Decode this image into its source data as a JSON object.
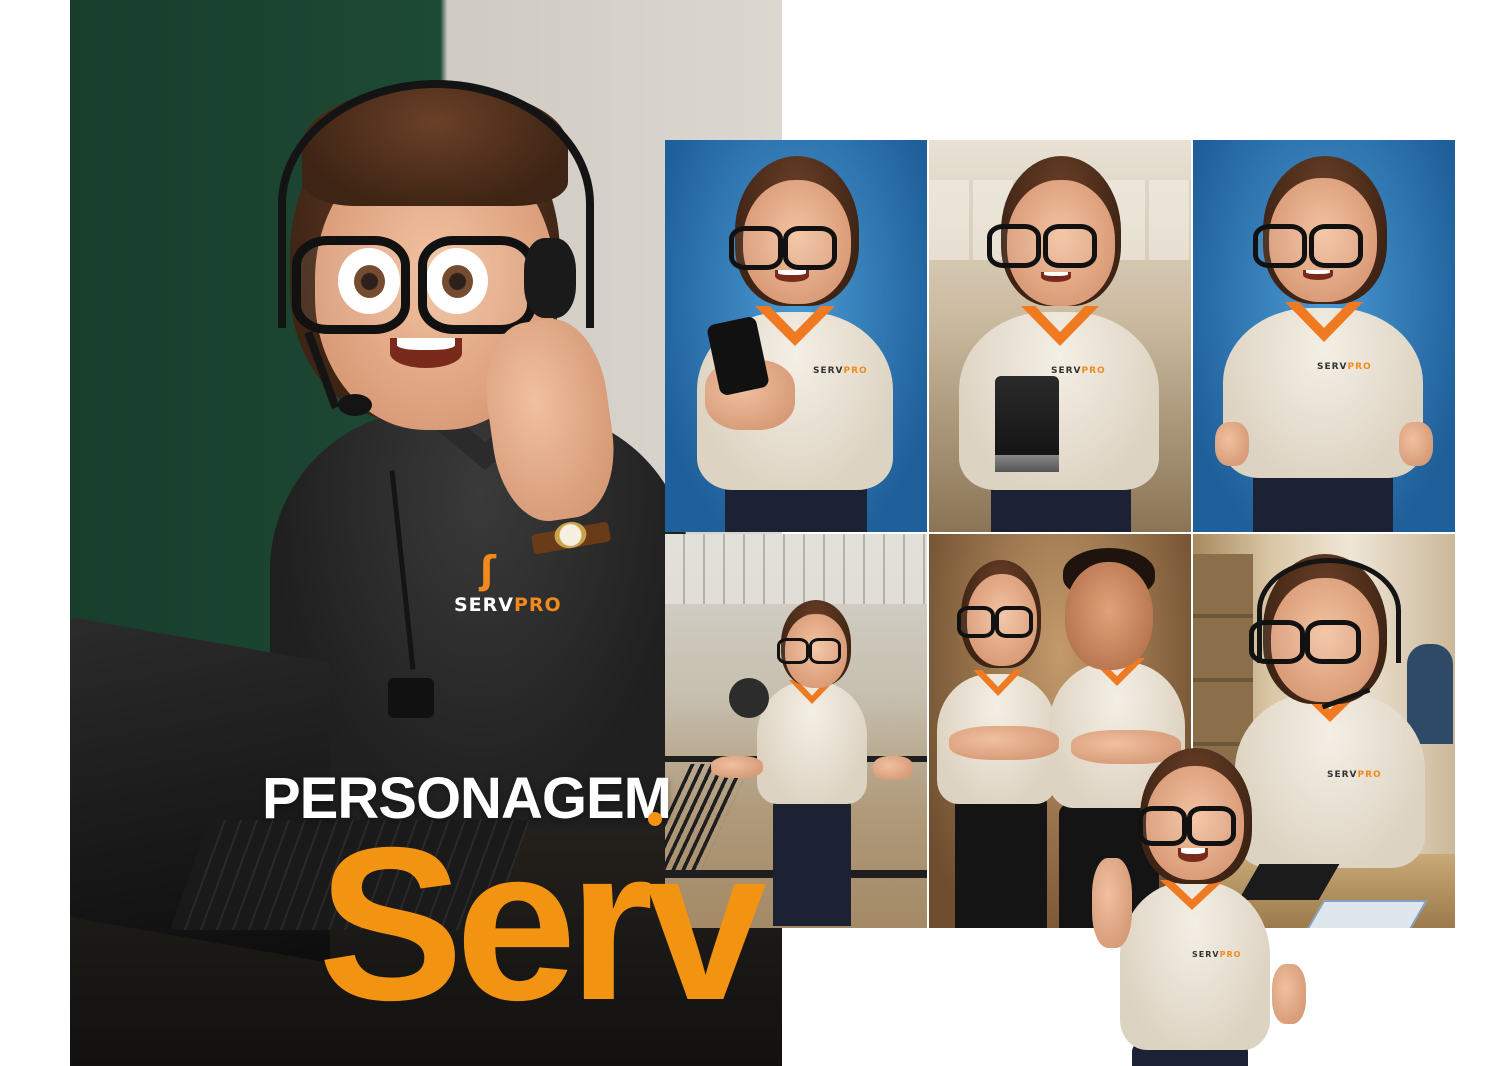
{
  "title": {
    "line1": "PERSONAGEM",
    "line2": "Serv"
  },
  "brand": {
    "logo_prefix": "SERV",
    "logo_suffix": "PRO",
    "accent_color": "#f39312",
    "collar_color": "#ef7a22"
  },
  "images": [
    {
      "id": "hero",
      "scene": "call-center-headset-laptop",
      "background": "dark-green-wall"
    },
    {
      "id": "thumb-1",
      "scene": "holding-smartphone",
      "background": "blue"
    },
    {
      "id": "thumb-2",
      "scene": "holding-device-office",
      "background": "office"
    },
    {
      "id": "thumb-3",
      "scene": "hands-on-hips",
      "background": "blue"
    },
    {
      "id": "thumb-4",
      "scene": "warehouse-presenting",
      "background": "warehouse"
    },
    {
      "id": "thumb-5",
      "scene": "duo-arms-crossed",
      "background": "warm-studio"
    },
    {
      "id": "thumb-6",
      "scene": "headset-at-desk",
      "background": "office"
    },
    {
      "id": "cutout",
      "scene": "pointing-up",
      "background": "transparent"
    }
  ]
}
